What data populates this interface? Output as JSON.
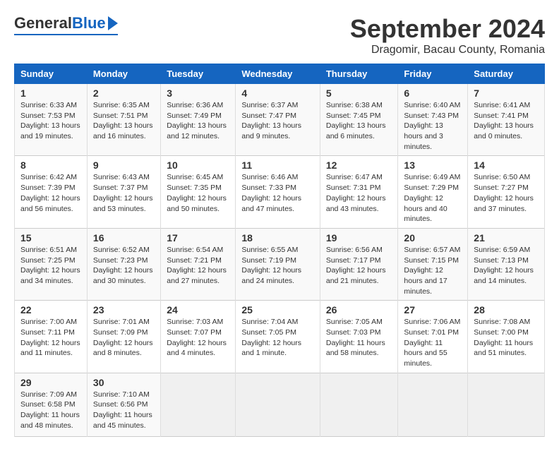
{
  "header": {
    "logo_general": "General",
    "logo_blue": "Blue",
    "month_title": "September 2024",
    "location": "Dragomir, Bacau County, Romania"
  },
  "weekdays": [
    "Sunday",
    "Monday",
    "Tuesday",
    "Wednesday",
    "Thursday",
    "Friday",
    "Saturday"
  ],
  "weeks": [
    [
      {
        "day": "1",
        "sunrise": "6:33 AM",
        "sunset": "7:53 PM",
        "daylight": "13 hours and 19 minutes."
      },
      {
        "day": "2",
        "sunrise": "6:35 AM",
        "sunset": "7:51 PM",
        "daylight": "13 hours and 16 minutes."
      },
      {
        "day": "3",
        "sunrise": "6:36 AM",
        "sunset": "7:49 PM",
        "daylight": "13 hours and 12 minutes."
      },
      {
        "day": "4",
        "sunrise": "6:37 AM",
        "sunset": "7:47 PM",
        "daylight": "13 hours and 9 minutes."
      },
      {
        "day": "5",
        "sunrise": "6:38 AM",
        "sunset": "7:45 PM",
        "daylight": "13 hours and 6 minutes."
      },
      {
        "day": "6",
        "sunrise": "6:40 AM",
        "sunset": "7:43 PM",
        "daylight": "13 hours and 3 minutes."
      },
      {
        "day": "7",
        "sunrise": "6:41 AM",
        "sunset": "7:41 PM",
        "daylight": "13 hours and 0 minutes."
      }
    ],
    [
      {
        "day": "8",
        "sunrise": "6:42 AM",
        "sunset": "7:39 PM",
        "daylight": "12 hours and 56 minutes."
      },
      {
        "day": "9",
        "sunrise": "6:43 AM",
        "sunset": "7:37 PM",
        "daylight": "12 hours and 53 minutes."
      },
      {
        "day": "10",
        "sunrise": "6:45 AM",
        "sunset": "7:35 PM",
        "daylight": "12 hours and 50 minutes."
      },
      {
        "day": "11",
        "sunrise": "6:46 AM",
        "sunset": "7:33 PM",
        "daylight": "12 hours and 47 minutes."
      },
      {
        "day": "12",
        "sunrise": "6:47 AM",
        "sunset": "7:31 PM",
        "daylight": "12 hours and 43 minutes."
      },
      {
        "day": "13",
        "sunrise": "6:49 AM",
        "sunset": "7:29 PM",
        "daylight": "12 hours and 40 minutes."
      },
      {
        "day": "14",
        "sunrise": "6:50 AM",
        "sunset": "7:27 PM",
        "daylight": "12 hours and 37 minutes."
      }
    ],
    [
      {
        "day": "15",
        "sunrise": "6:51 AM",
        "sunset": "7:25 PM",
        "daylight": "12 hours and 34 minutes."
      },
      {
        "day": "16",
        "sunrise": "6:52 AM",
        "sunset": "7:23 PM",
        "daylight": "12 hours and 30 minutes."
      },
      {
        "day": "17",
        "sunrise": "6:54 AM",
        "sunset": "7:21 PM",
        "daylight": "12 hours and 27 minutes."
      },
      {
        "day": "18",
        "sunrise": "6:55 AM",
        "sunset": "7:19 PM",
        "daylight": "12 hours and 24 minutes."
      },
      {
        "day": "19",
        "sunrise": "6:56 AM",
        "sunset": "7:17 PM",
        "daylight": "12 hours and 21 minutes."
      },
      {
        "day": "20",
        "sunrise": "6:57 AM",
        "sunset": "7:15 PM",
        "daylight": "12 hours and 17 minutes."
      },
      {
        "day": "21",
        "sunrise": "6:59 AM",
        "sunset": "7:13 PM",
        "daylight": "12 hours and 14 minutes."
      }
    ],
    [
      {
        "day": "22",
        "sunrise": "7:00 AM",
        "sunset": "7:11 PM",
        "daylight": "12 hours and 11 minutes."
      },
      {
        "day": "23",
        "sunrise": "7:01 AM",
        "sunset": "7:09 PM",
        "daylight": "12 hours and 8 minutes."
      },
      {
        "day": "24",
        "sunrise": "7:03 AM",
        "sunset": "7:07 PM",
        "daylight": "12 hours and 4 minutes."
      },
      {
        "day": "25",
        "sunrise": "7:04 AM",
        "sunset": "7:05 PM",
        "daylight": "12 hours and 1 minute."
      },
      {
        "day": "26",
        "sunrise": "7:05 AM",
        "sunset": "7:03 PM",
        "daylight": "11 hours and 58 minutes."
      },
      {
        "day": "27",
        "sunrise": "7:06 AM",
        "sunset": "7:01 PM",
        "daylight": "11 hours and 55 minutes."
      },
      {
        "day": "28",
        "sunrise": "7:08 AM",
        "sunset": "7:00 PM",
        "daylight": "11 hours and 51 minutes."
      }
    ],
    [
      {
        "day": "29",
        "sunrise": "7:09 AM",
        "sunset": "6:58 PM",
        "daylight": "11 hours and 48 minutes."
      },
      {
        "day": "30",
        "sunrise": "7:10 AM",
        "sunset": "6:56 PM",
        "daylight": "11 hours and 45 minutes."
      },
      null,
      null,
      null,
      null,
      null
    ]
  ]
}
